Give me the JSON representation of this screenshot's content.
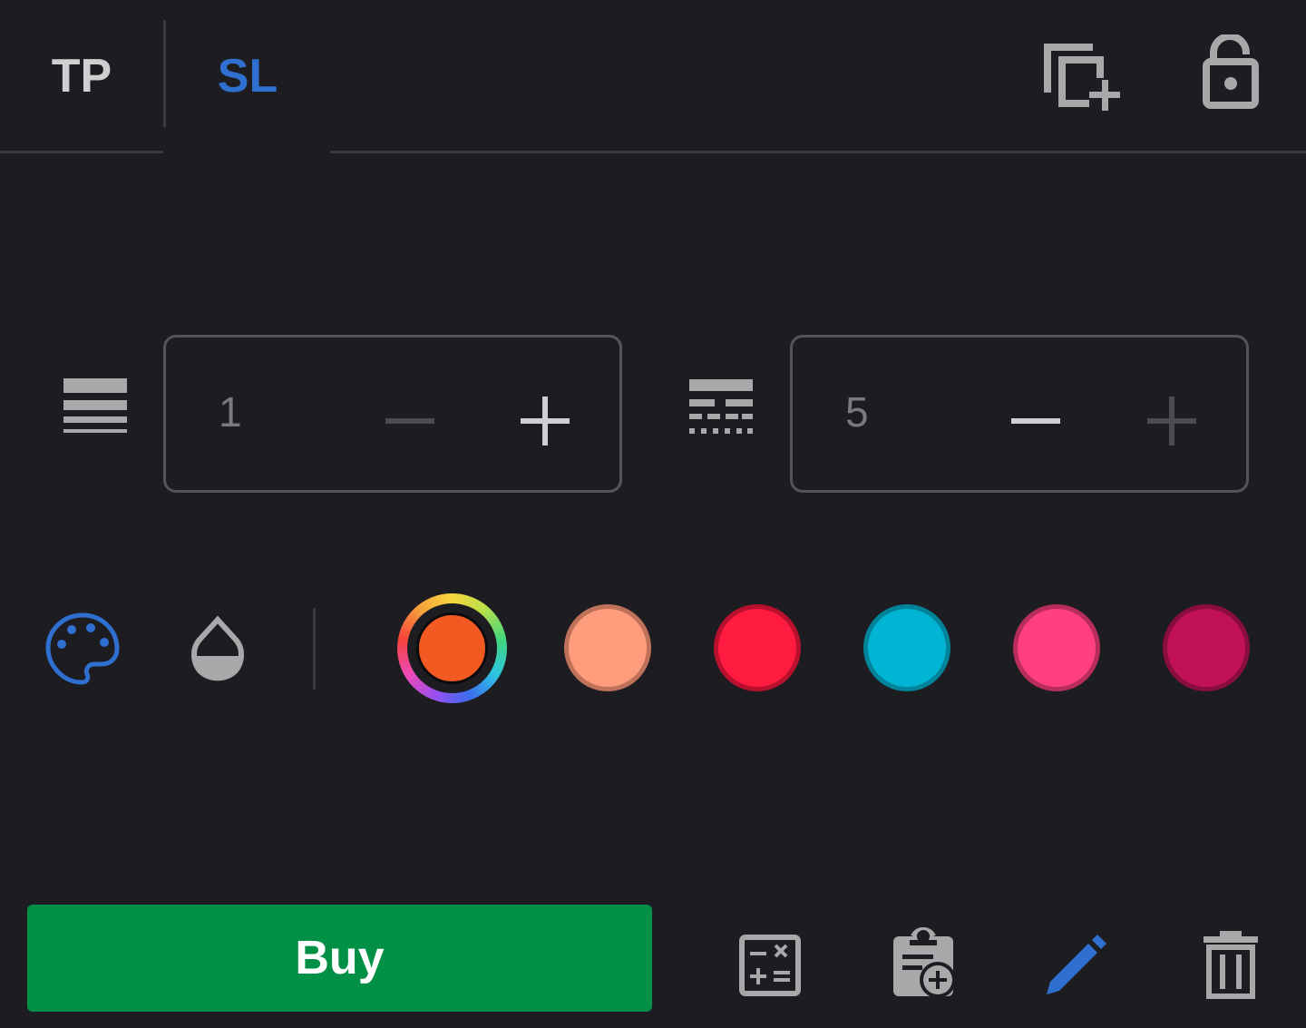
{
  "tabs": [
    {
      "label": "TP",
      "active": false
    },
    {
      "label": "SL",
      "active": true
    }
  ],
  "header_icons": [
    "copy-add-icon",
    "lock-open-icon"
  ],
  "line_width": {
    "icon": "line-thickness-icon",
    "value": "1"
  },
  "line_style": {
    "icon": "line-style-icon",
    "value": "5"
  },
  "color_row": {
    "icons": [
      "palette-icon",
      "opacity-icon"
    ],
    "selected_color": "#f25a22",
    "swatches": [
      "#ff9c7c",
      "#ff1a40",
      "#00b5d4",
      "#ff3f81",
      "#c11258"
    ]
  },
  "buy_button": {
    "label": "Buy",
    "color": "#029046"
  },
  "bottom_icons": [
    "calculator-icon",
    "clipboard-add-icon",
    "pencil-icon",
    "trash-icon"
  ],
  "accent_color": "#2f6fd0"
}
